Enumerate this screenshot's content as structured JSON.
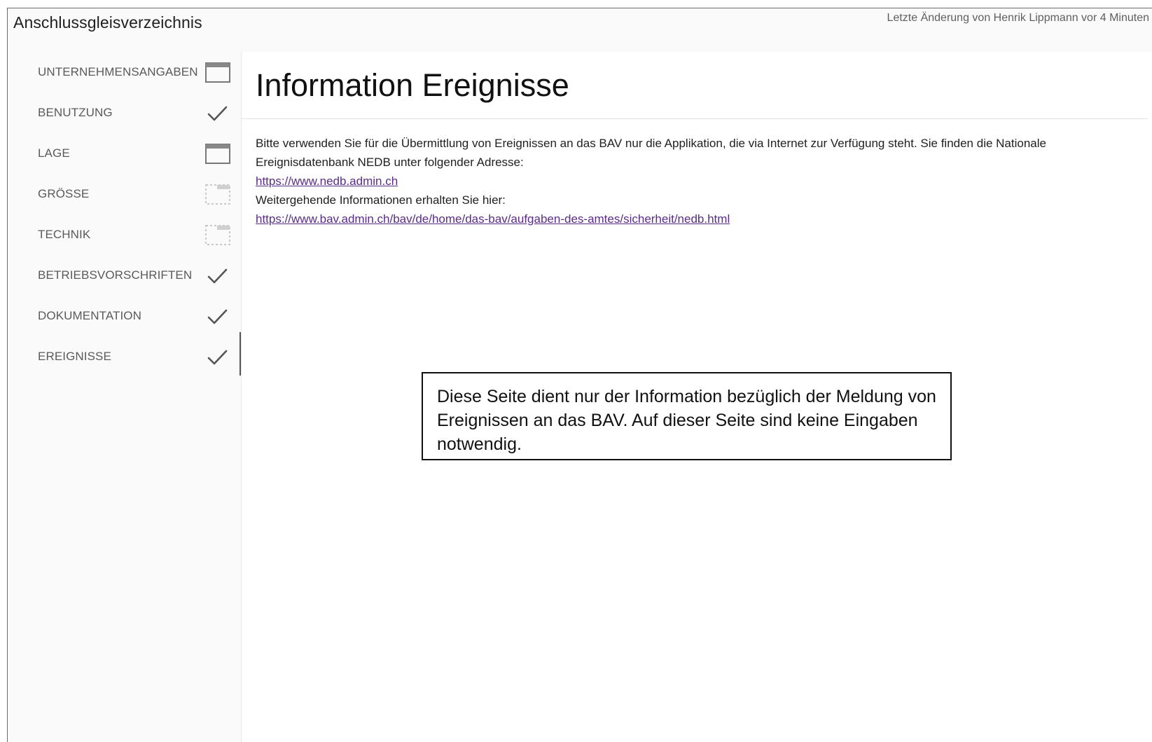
{
  "app": {
    "title": "Anschlussgleisverzeichnis",
    "last_change": "Letzte Änderung von Henrik Lippmann vor 4 Minuten"
  },
  "sidebar": {
    "items": [
      {
        "label": "UNTERNEHMENSANGABEN",
        "status_icon": "empty-form-icon",
        "active": false
      },
      {
        "label": "BENUTZUNG",
        "status_icon": "check-icon",
        "active": false
      },
      {
        "label": "LAGE",
        "status_icon": "empty-form-icon",
        "active": false
      },
      {
        "label": "GRÖSSE",
        "status_icon": "dotted-form-icon",
        "active": false
      },
      {
        "label": "TECHNIK",
        "status_icon": "dotted-form-icon",
        "active": false
      },
      {
        "label": "BETRIEBSVORSCHRIFTEN",
        "status_icon": "check-icon",
        "active": false
      },
      {
        "label": "DOKUMENTATION",
        "status_icon": "check-icon",
        "active": false
      },
      {
        "label": "EREIGNISSE",
        "status_icon": "check-icon",
        "active": true
      }
    ]
  },
  "main": {
    "title": "Information Ereignisse",
    "text_line1": "Bitte verwenden Sie für die Übermittlung von Ereignissen an das BAV nur die Applikation, die via Internet zur Verfügung steht. Sie finden die Nationale Ereignisdatenbank NEDB unter folgender Adresse:",
    "link1": "https://www.nedb.admin.ch",
    "text_line2": "Weitergehende Informationen erhalten Sie hier:",
    "link2": "https://www.bav.admin.ch/bav/de/home/das-bav/aufgaben-des-amtes/sicherheit/nedb.html",
    "note": "Diese Seite dient nur der Information bezüglich der Meldung von Ereignissen an das BAV. Auf dieser Seite sind keine Eingaben notwendig."
  },
  "colors": {
    "link": "#5a2c86",
    "nav_text": "#5a5a5a",
    "icon": "#555555"
  }
}
